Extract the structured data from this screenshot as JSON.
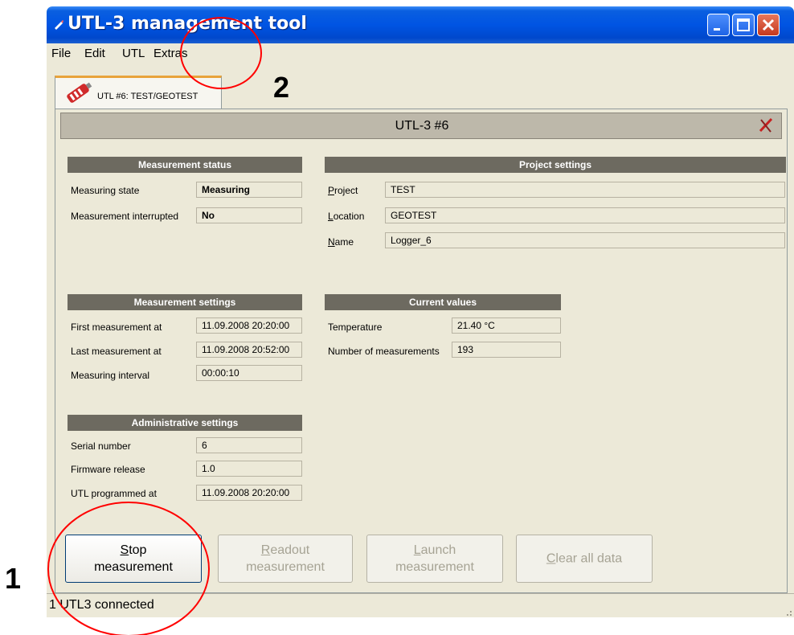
{
  "window": {
    "title": "UTL-3 management tool"
  },
  "menu": {
    "items": [
      "File",
      "Edit",
      "UTL",
      "Extras"
    ]
  },
  "tab": {
    "label": "UTL #6: TEST/GEOTEST"
  },
  "panel": {
    "title": "UTL-3 #6"
  },
  "measurement_status": {
    "header": "Measurement status",
    "rows": [
      {
        "label": "Measuring state",
        "value": "Measuring"
      },
      {
        "label": "Measurement interrupted",
        "value": "No"
      }
    ]
  },
  "project_settings": {
    "header": "Project settings",
    "rows": [
      {
        "label": "Project",
        "value": "TEST"
      },
      {
        "label": "Location",
        "value": "GEOTEST"
      },
      {
        "label": "Name",
        "value": "Logger_6"
      }
    ]
  },
  "measurement_settings": {
    "header": "Measurement settings",
    "rows": [
      {
        "label": "First measurement at",
        "value": "11.09.2008 20:20:00"
      },
      {
        "label": "Last measurement at",
        "value": "11.09.2008 20:52:00"
      },
      {
        "label": "Measuring interval",
        "value": "00:00:10"
      }
    ]
  },
  "current_values": {
    "header": "Current values",
    "rows": [
      {
        "label": "Temperature",
        "value": "21.40 °C"
      },
      {
        "label": "Number of measurements",
        "value": "193"
      }
    ]
  },
  "administrative_settings": {
    "header": "Administrative settings",
    "rows": [
      {
        "label": "Serial number",
        "value": "6"
      },
      {
        "label": "Firmware release",
        "value": "1.0"
      },
      {
        "label": "UTL programmed at",
        "value": "11.09.2008 20:20:00"
      }
    ]
  },
  "buttons": {
    "stop": {
      "l1a": "S",
      "l1b": "top",
      "l2": "measurement"
    },
    "readout": {
      "l1a": "R",
      "l1b": "eadout",
      "l2": "measurement"
    },
    "launch": {
      "l1a": "L",
      "l1b": "aunch",
      "l2": "measurement"
    },
    "clear": {
      "a": "C",
      "b": "lear all data"
    }
  },
  "status": {
    "text": "1 UTL3 connected"
  },
  "annotations": {
    "one": "1",
    "two": "2"
  },
  "colors": {
    "title_blue": "#0054e3",
    "annotation_red": "#ff0000",
    "section_header": "#6d6a60"
  }
}
